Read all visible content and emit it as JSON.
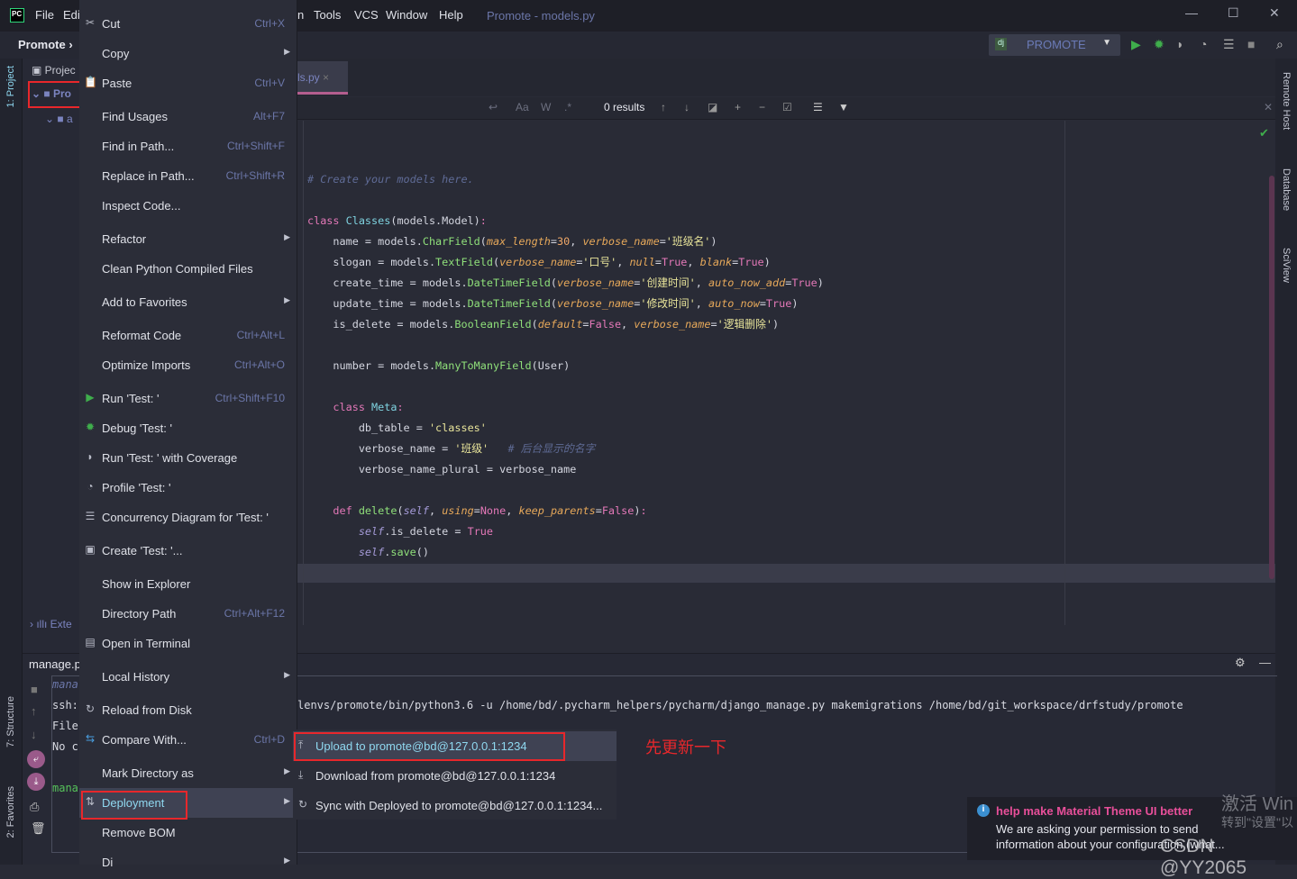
{
  "titlebar": {
    "menus": [
      "File",
      "Edi",
      "n",
      "Tools",
      "VCS",
      "Window",
      "Help"
    ],
    "title": "Promote - models.py",
    "logo": "PC"
  },
  "navbar": {
    "breadcrumb": "Promote",
    "run_config": "PROMOTE",
    "run_config_icon": "dj"
  },
  "left_stripe": {
    "project": "1: Project",
    "structure": "7: Structure",
    "favorites": "2: Favorites"
  },
  "right_stripe": {
    "remote_host": "Remote Host",
    "database": "Database",
    "sciview": "SciView"
  },
  "project_tree": {
    "items": [
      "Projec",
      "Pro",
      "a",
      "Exte"
    ],
    "bottom_title": "manage.p"
  },
  "editor": {
    "tab": "ls.py",
    "find": {
      "results": "0 results",
      "match_case": "Aa",
      "words": "W",
      "regex": ".*"
    },
    "lines": [
      [
        [
          "# Create your models here.",
          "cm"
        ]
      ],
      [],
      [
        [
          "class ",
          "kw"
        ],
        [
          "Classes",
          "cls"
        ],
        [
          "(models.Model)",
          "pun"
        ],
        [
          ":",
          "kw"
        ]
      ],
      [
        [
          "    name = models.",
          "pun"
        ],
        [
          "CharField",
          "fn"
        ],
        [
          "(",
          "pun"
        ],
        [
          "max_length",
          "par"
        ],
        [
          "=",
          "pun"
        ],
        [
          "30",
          "num"
        ],
        [
          ", ",
          "pun"
        ],
        [
          "verbose_name",
          "par"
        ],
        [
          "=",
          "pun"
        ],
        [
          "'班级名'",
          "str"
        ],
        [
          ")",
          "pun"
        ]
      ],
      [
        [
          "    slogan = models.",
          "pun"
        ],
        [
          "TextField",
          "fn"
        ],
        [
          "(",
          "pun"
        ],
        [
          "verbose_name",
          "par"
        ],
        [
          "=",
          "pun"
        ],
        [
          "'口号'",
          "str"
        ],
        [
          ", ",
          "pun"
        ],
        [
          "null",
          "par"
        ],
        [
          "=",
          "pun"
        ],
        [
          "True",
          "bool"
        ],
        [
          ", ",
          "pun"
        ],
        [
          "blank",
          "par"
        ],
        [
          "=",
          "pun"
        ],
        [
          "True",
          "bool"
        ],
        [
          ")",
          "pun"
        ]
      ],
      [
        [
          "    create_time = models.",
          "pun"
        ],
        [
          "DateTimeField",
          "fn"
        ],
        [
          "(",
          "pun"
        ],
        [
          "verbose_name",
          "par"
        ],
        [
          "=",
          "pun"
        ],
        [
          "'创建时间'",
          "str"
        ],
        [
          ", ",
          "pun"
        ],
        [
          "auto_now_add",
          "par"
        ],
        [
          "=",
          "pun"
        ],
        [
          "True",
          "bool"
        ],
        [
          ")",
          "pun"
        ]
      ],
      [
        [
          "    update_time = models.",
          "pun"
        ],
        [
          "DateTimeField",
          "fn"
        ],
        [
          "(",
          "pun"
        ],
        [
          "verbose_name",
          "par"
        ],
        [
          "=",
          "pun"
        ],
        [
          "'修改时间'",
          "str"
        ],
        [
          ", ",
          "pun"
        ],
        [
          "auto_now",
          "par"
        ],
        [
          "=",
          "pun"
        ],
        [
          "True",
          "bool"
        ],
        [
          ")",
          "pun"
        ]
      ],
      [
        [
          "    is_delete = models.",
          "pun"
        ],
        [
          "BooleanField",
          "fn"
        ],
        [
          "(",
          "pun"
        ],
        [
          "default",
          "par"
        ],
        [
          "=",
          "pun"
        ],
        [
          "False",
          "bool"
        ],
        [
          ", ",
          "pun"
        ],
        [
          "verbose_name",
          "par"
        ],
        [
          "=",
          "pun"
        ],
        [
          "'逻辑删除'",
          "str"
        ],
        [
          ")",
          "pun"
        ]
      ],
      [],
      [
        [
          "    number = models.",
          "pun"
        ],
        [
          "ManyToManyField",
          "fn"
        ],
        [
          "(User)",
          "pun"
        ]
      ],
      [],
      [
        [
          "    class ",
          "kw"
        ],
        [
          "Meta",
          "cls"
        ],
        [
          ":",
          "kw"
        ]
      ],
      [
        [
          "        db_table = ",
          "pun"
        ],
        [
          "'classes'",
          "str"
        ]
      ],
      [
        [
          "        verbose_name = ",
          "pun"
        ],
        [
          "'班级'",
          "str"
        ],
        [
          "   # 后台显示的名字",
          "cm"
        ]
      ],
      [
        [
          "        verbose_name_plural = verbose_name",
          "pun"
        ]
      ],
      [],
      [
        [
          "    def ",
          "kw"
        ],
        [
          "delete",
          "fn"
        ],
        [
          "(",
          "pun"
        ],
        [
          "self",
          "self"
        ],
        [
          ", ",
          "pun"
        ],
        [
          "using",
          "par"
        ],
        [
          "=",
          "pun"
        ],
        [
          "None",
          "bool"
        ],
        [
          ", ",
          "pun"
        ],
        [
          "keep_parents",
          "par"
        ],
        [
          "=",
          "pun"
        ],
        [
          "False",
          "bool"
        ],
        [
          ")",
          "pun"
        ],
        [
          ":",
          "kw"
        ]
      ],
      [
        [
          "        ",
          "pun"
        ],
        [
          "self",
          "self"
        ],
        [
          ".is_delete = ",
          "pun"
        ],
        [
          "True",
          "bool"
        ]
      ],
      [
        [
          "        ",
          "pun"
        ],
        [
          "self",
          "self"
        ],
        [
          ".",
          "pun"
        ],
        [
          "save",
          "fn"
        ],
        [
          "()",
          "pun"
        ]
      ]
    ]
  },
  "terminal": {
    "lines": [
      {
        "left": "mana",
        "right": ""
      },
      {
        "left": "ssh:",
        "right": "lenvs/promote/bin/python3.6 -u /home/bd/.pycharm_helpers/pycharm/django_manage.py makemigrations /home/bd/git_workspace/drfstudy/promote"
      },
      {
        "left": "File",
        "right": ""
      },
      {
        "left": "No c",
        "right": ""
      },
      {
        "left": "",
        "right": ""
      },
      {
        "left": "mana",
        "right": ""
      }
    ]
  },
  "context_menu": [
    {
      "label": "Cut",
      "shortcut": "Ctrl+X",
      "icon": "✂"
    },
    {
      "label": "Copy",
      "submenu": true
    },
    {
      "label": "Paste",
      "shortcut": "Ctrl+V",
      "icon": "📋"
    },
    {
      "separator": true
    },
    {
      "label": "Find Usages",
      "shortcut": "Alt+F7"
    },
    {
      "label": "Find in Path...",
      "shortcut": "Ctrl+Shift+F"
    },
    {
      "label": "Replace in Path...",
      "shortcut": "Ctrl+Shift+R"
    },
    {
      "label": "Inspect Code..."
    },
    {
      "separator": true
    },
    {
      "label": "Refactor",
      "submenu": true
    },
    {
      "label": "Clean Python Compiled Files"
    },
    {
      "separator": true
    },
    {
      "label": "Add to Favorites",
      "submenu": true
    },
    {
      "separator": true
    },
    {
      "label": "Reformat Code",
      "shortcut": "Ctrl+Alt+L"
    },
    {
      "label": "Optimize Imports",
      "shortcut": "Ctrl+Alt+O"
    },
    {
      "separator": true
    },
    {
      "label": "Run 'Test: '",
      "shortcut": "Ctrl+Shift+F10",
      "icon": "▶",
      "icon_color": "#3fae4c"
    },
    {
      "label": "Debug 'Test: '",
      "icon": "✹",
      "icon_color": "#3fae4c"
    },
    {
      "label": "Run 'Test: ' with Coverage",
      "icon": "◗"
    },
    {
      "label": "Profile 'Test: '",
      "icon": "◔"
    },
    {
      "label": "Concurrency Diagram for 'Test: '",
      "icon": "☰"
    },
    {
      "separator": true
    },
    {
      "label": "Create 'Test: '...",
      "icon": "▣"
    },
    {
      "separator": true
    },
    {
      "label": "Show in Explorer"
    },
    {
      "label": "Directory Path",
      "shortcut": "Ctrl+Alt+F12"
    },
    {
      "label": "Open in Terminal",
      "icon": "▤"
    },
    {
      "separator": true
    },
    {
      "label": "Local History",
      "submenu": true
    },
    {
      "separator": true
    },
    {
      "label": "Reload from Disk",
      "icon": "↻"
    },
    {
      "label": "Compare With...",
      "shortcut": "Ctrl+D",
      "icon": "⇆",
      "icon_color": "#4a9fe0"
    },
    {
      "separator": true
    },
    {
      "label": "Mark Directory as",
      "submenu": true
    },
    {
      "label": "Deployment",
      "submenu": true,
      "selected": true,
      "icon": "⇅"
    },
    {
      "label": "Remove BOM"
    },
    {
      "label": "Di",
      "submenu": true
    }
  ],
  "submenu": [
    {
      "label": "Upload to promote@bd@127.0.0.1:1234",
      "icon": "⤒",
      "selected": true
    },
    {
      "label": "Download from promote@bd@127.0.0.1:1234",
      "icon": "⤓"
    },
    {
      "label": "Sync with Deployed to promote@bd@127.0.0.1:1234...",
      "icon": "↻"
    }
  ],
  "annotation": "先更新一下",
  "notification": {
    "title": "help make Material Theme UI better",
    "body1": "We are asking your permission to send",
    "body2": "information about your configuration (what..."
  },
  "watermark": {
    "activate": "激活 Win",
    "activate2": "转到\"设置\"以",
    "csdn": "CSDN @YY2065"
  },
  "colors": {
    "accent": "#8fd8f0",
    "highlight_box": "#e8272b",
    "notif_title": "#e84f9a"
  }
}
